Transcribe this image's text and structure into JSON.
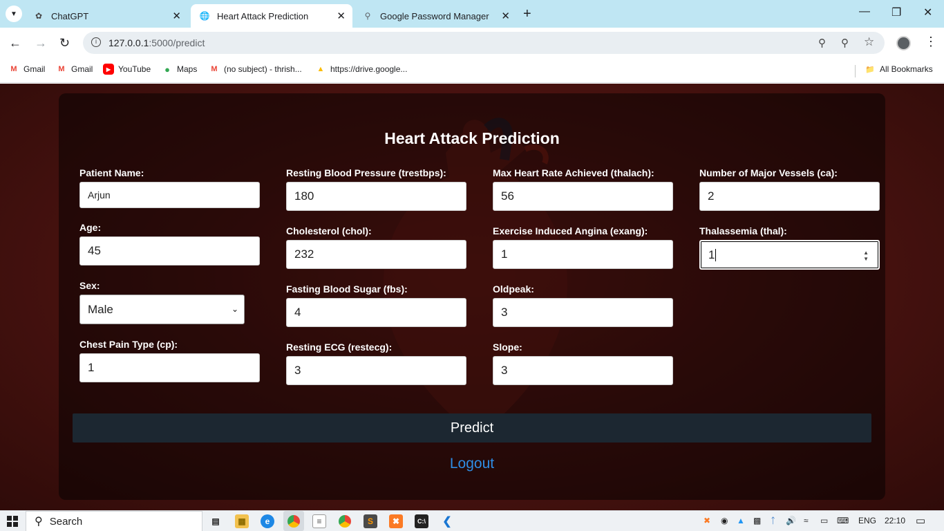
{
  "browser": {
    "tabs": [
      {
        "title": "ChatGPT",
        "icon": "chatgpt-icon"
      },
      {
        "title": "Heart Attack Prediction",
        "icon": "globe-icon",
        "active": true
      },
      {
        "title": "Google Password Manager",
        "icon": "key-icon"
      }
    ],
    "url_host": "127.0.0.1",
    "url_rest": ":5000/predict",
    "bookmarks": [
      {
        "label": "Gmail",
        "icon": "gmail-icon",
        "color": "#ea4335"
      },
      {
        "label": "Gmail",
        "icon": "gmail-icon",
        "color": "#ea4335"
      },
      {
        "label": "YouTube",
        "icon": "youtube-icon",
        "color": "#ff0000"
      },
      {
        "label": "Maps",
        "icon": "maps-icon",
        "color": "#34a853"
      },
      {
        "label": "(no subject) - thrish...",
        "icon": "gmail-icon",
        "color": "#ea4335"
      },
      {
        "label": "https://drive.google...",
        "icon": "drive-icon",
        "color": "#fbbc04"
      }
    ],
    "all_bookmarks": "All Bookmarks"
  },
  "form": {
    "title": "Heart Attack Prediction",
    "fields": {
      "patient_name": {
        "label": "Patient Name:",
        "value": "Arjun"
      },
      "age": {
        "label": "Age:",
        "value": "45"
      },
      "sex": {
        "label": "Sex:",
        "value": "Male"
      },
      "cp": {
        "label": "Chest Pain Type (cp):",
        "value": "1"
      },
      "trestbps": {
        "label": "Resting Blood Pressure (trestbps):",
        "value": "180"
      },
      "chol": {
        "label": "Cholesterol (chol):",
        "value": "232"
      },
      "fbs": {
        "label": "Fasting Blood Sugar (fbs):",
        "value": "4"
      },
      "restecg": {
        "label": "Resting ECG (restecg):",
        "value": "3"
      },
      "thalach": {
        "label": "Max Heart Rate Achieved (thalach):",
        "value": "56"
      },
      "exang": {
        "label": "Exercise Induced Angina (exang):",
        "value": "1"
      },
      "oldpeak": {
        "label": "Oldpeak:",
        "value": "3"
      },
      "slope": {
        "label": "Slope:",
        "value": "3"
      },
      "ca": {
        "label": "Number of Major Vessels (ca):",
        "value": "2"
      },
      "thal": {
        "label": "Thalassemia (thal):",
        "value": "1"
      }
    },
    "predict_label": "Predict",
    "logout_label": "Logout",
    "colors": {
      "button": "#1c2731",
      "link": "#2f8de4"
    }
  },
  "taskbar": {
    "search_label": "Search",
    "language": "ENG",
    "time": "22:10"
  }
}
